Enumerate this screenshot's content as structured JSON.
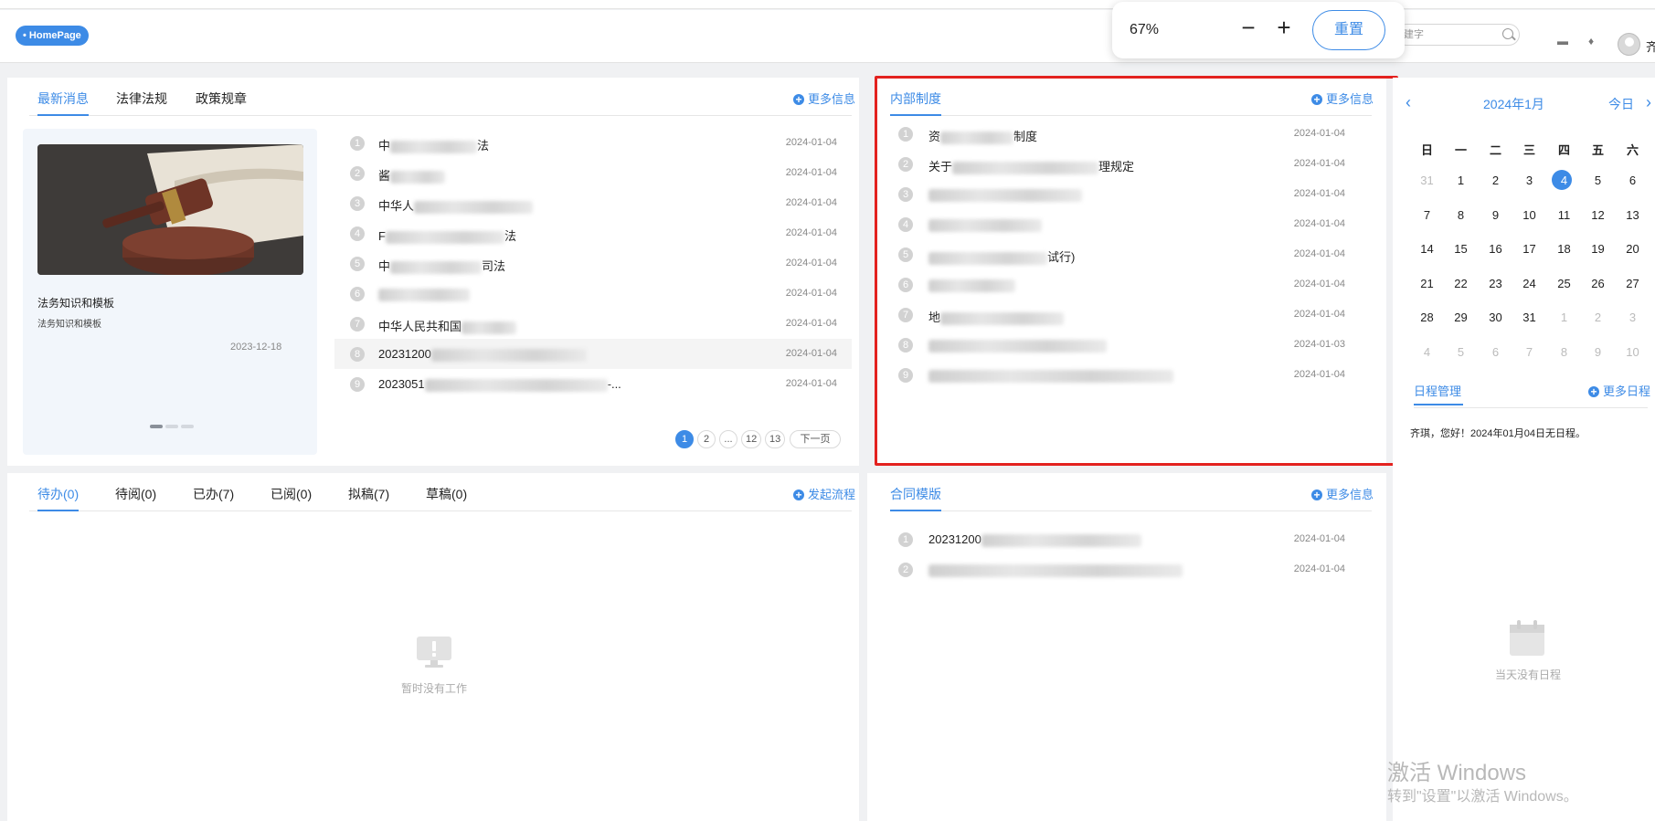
{
  "header": {
    "home_label": "HomePage",
    "search_placeholder": "建字",
    "user_name": "齐"
  },
  "zoom": {
    "level": "67%",
    "minus": "−",
    "plus": "+",
    "reset": "重置"
  },
  "news": {
    "tabs": [
      "最新消息",
      "法律法规",
      "政策规章"
    ],
    "more": "更多信息",
    "card": {
      "title": "法务知识和模板",
      "subtitle": "法务知识和模板",
      "date": "2023-12-18"
    },
    "rows": [
      {
        "n": "1",
        "prefix": "中",
        "suffix": "法",
        "date": "2024-01-04"
      },
      {
        "n": "2",
        "prefix": "酱",
        "suffix": "",
        "date": "2024-01-04"
      },
      {
        "n": "3",
        "prefix": "中华人",
        "suffix": "",
        "date": "2024-01-04"
      },
      {
        "n": "4",
        "prefix": "F",
        "suffix": "法",
        "date": "2024-01-04"
      },
      {
        "n": "5",
        "prefix": "中",
        "suffix": "司法",
        "date": "2024-01-04"
      },
      {
        "n": "6",
        "prefix": "",
        "suffix": "",
        "date": "2024-01-04"
      },
      {
        "n": "7",
        "prefix": "中华人民共和国",
        "suffix": "",
        "date": "2024-01-04"
      },
      {
        "n": "8",
        "prefix": "20231200",
        "suffix": "",
        "date": "2024-01-04"
      },
      {
        "n": "9",
        "prefix": "2023051",
        "suffix": "-...",
        "date": "2024-01-04"
      }
    ],
    "pager": [
      "1",
      "2",
      "...",
      "12",
      "13"
    ],
    "next": "下一页"
  },
  "internal": {
    "tab": "内部制度",
    "more": "更多信息",
    "rows": [
      {
        "n": "1",
        "prefix": "资",
        "suffix": "制度",
        "date": "2024-01-04"
      },
      {
        "n": "2",
        "prefix": "关于",
        "suffix": "理规定",
        "date": "2024-01-04"
      },
      {
        "n": "3",
        "prefix": "",
        "suffix": "",
        "date": "2024-01-04"
      },
      {
        "n": "4",
        "prefix": "",
        "suffix": "",
        "date": "2024-01-04"
      },
      {
        "n": "5",
        "prefix": "",
        "suffix": "试行)",
        "date": "2024-01-04"
      },
      {
        "n": "6",
        "prefix": "",
        "suffix": "",
        "date": "2024-01-04"
      },
      {
        "n": "7",
        "prefix": "地",
        "suffix": "",
        "date": "2024-01-04"
      },
      {
        "n": "8",
        "prefix": "",
        "suffix": "",
        "date": "2024-01-03"
      },
      {
        "n": "9",
        "prefix": "",
        "suffix": "",
        "date": "2024-01-04"
      }
    ]
  },
  "calendar": {
    "title": "2024年1月",
    "today_label": "今日",
    "weekdays": [
      "日",
      "一",
      "二",
      "三",
      "四",
      "五",
      "六"
    ],
    "weeks": [
      [
        "31",
        "1",
        "2",
        "3",
        "4",
        "5",
        "6"
      ],
      [
        "7",
        "8",
        "9",
        "10",
        "11",
        "12",
        "13"
      ],
      [
        "14",
        "15",
        "16",
        "17",
        "18",
        "19",
        "20"
      ],
      [
        "21",
        "22",
        "23",
        "24",
        "25",
        "26",
        "27"
      ],
      [
        "28",
        "29",
        "30",
        "31",
        "1",
        "2",
        "3"
      ],
      [
        "4",
        "5",
        "6",
        "7",
        "8",
        "9",
        "10"
      ]
    ],
    "schedule_tab": "日程管理",
    "schedule_more": "更多日程",
    "schedule_msg": "齐琪，您好！2024年01月04日无日程。",
    "empty_text": "当天没有日程"
  },
  "workflow": {
    "tabs": [
      "待办(0)",
      "待阅(0)",
      "已办(7)",
      "已阅(0)",
      "拟稿(7)",
      "草稿(0)"
    ],
    "action": "发起流程",
    "empty_text": "暂时没有工作"
  },
  "contracts": {
    "tab": "合同模版",
    "more": "更多信息",
    "rows": [
      {
        "n": "1",
        "prefix": "20231200",
        "suffix": "",
        "date": "2024-01-04"
      },
      {
        "n": "2",
        "prefix": "",
        "suffix": "",
        "date": "2024-01-04"
      }
    ]
  },
  "watermark": {
    "line1": "激活 Windows",
    "line2": "转到\"设置\"以激活 Windows。"
  },
  "colors": {
    "accent": "#3d8be6",
    "highlight_box": "#e3221f"
  }
}
